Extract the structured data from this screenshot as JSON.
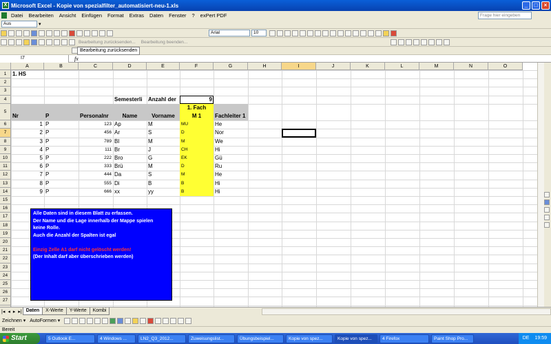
{
  "window": {
    "title": "Microsoft Excel - Kopie von spezialfilter_automatisiert-neu-1.xls",
    "minimize": "_",
    "maximize": "□",
    "close": "×"
  },
  "menu": [
    "Datei",
    "Bearbeiten",
    "Ansicht",
    "Einfügen",
    "Format",
    "Extras",
    "Daten",
    "Fenster",
    "?",
    "exPert PDF"
  ],
  "help_placeholder": "Frage hier eingeben",
  "toolbar1": {
    "combo": "Aus"
  },
  "toolbar2": {
    "font": "Arial",
    "size": "10",
    "review_back": "Bearbeitung zurücksenden...",
    "review_end": "Bearbeitung beenden...",
    "send_label": "Bearbeitung zurücksenden"
  },
  "formula": {
    "namebox": "I7",
    "fx": "fx",
    "value": ""
  },
  "columns": [
    "A",
    "B",
    "C",
    "D",
    "E",
    "F",
    "G",
    "H",
    "I",
    "J",
    "K",
    "L",
    "M",
    "N",
    "O"
  ],
  "rows": [
    "1",
    "2",
    "3",
    "4",
    "5",
    "6",
    "7",
    "8",
    "9",
    "10",
    "11",
    "12",
    "13",
    "14",
    "15",
    "16",
    "17",
    "18",
    "19",
    "20",
    "21",
    "22",
    "23",
    "24",
    "25",
    "26",
    "27",
    "28"
  ],
  "sheet": {
    "title": "1. HS",
    "semester_label": "Semesterli",
    "anzahl_label": "Anzahl der",
    "anzahl_value": "9",
    "headers": {
      "nr": "Nr",
      "p": "P",
      "personal": "Personalnr",
      "name": "Name",
      "vorname": "Vorname",
      "fach1": "1. Fach",
      "fach2": "M 1",
      "fachleiter": "Fachleiter 1"
    },
    "data": [
      {
        "nr": "1",
        "p": "P",
        "pn": "123",
        "name": "Ap",
        "vor": "M",
        "fach": "MU",
        "fl": "He"
      },
      {
        "nr": "2",
        "p": "P",
        "pn": "456",
        "name": "Ar",
        "vor": "S",
        "fach": "D",
        "fl": "Nor"
      },
      {
        "nr": "3",
        "p": "P",
        "pn": "789",
        "name": "Bl",
        "vor": "M",
        "fach": "M",
        "fl": "We"
      },
      {
        "nr": "4",
        "p": "P",
        "pn": "111",
        "name": "Br",
        "vor": "J",
        "fach": "CH",
        "fl": "Hi"
      },
      {
        "nr": "5",
        "p": "P",
        "pn": "222",
        "name": "Bro",
        "vor": "G",
        "fach": "EK",
        "fl": "Gü"
      },
      {
        "nr": "6",
        "p": "P",
        "pn": "333",
        "name": "Brü",
        "vor": "M",
        "fach": "D",
        "fl": "Ru"
      },
      {
        "nr": "7",
        "p": "P",
        "pn": "444",
        "name": "Da",
        "vor": "S",
        "fach": "M",
        "fl": "He"
      },
      {
        "nr": "8",
        "p": "P",
        "pn": "555",
        "name": "Di",
        "vor": "B",
        "fach": "B",
        "fl": "Hi"
      },
      {
        "nr": "9",
        "p": "P",
        "pn": "666",
        "name": "xx",
        "vor": "yy",
        "fach": "B",
        "fl": "Hi"
      }
    ],
    "note_lines": [
      "Alle Daten sind in diesem Blatt zu erfassen.",
      "Der Name und die Lage innerhalb der Mappe spielen",
      "keine Rolle.",
      "Auch die Anzahl der Spalten ist egal"
    ],
    "note_warning": "Einzig Zelle A1 darf nicht gelöscht werden!",
    "note_extra": "(Der Inhalt darf aber überschrieben werden)"
  },
  "tabs": [
    "Daten",
    "X-Werte",
    "Y-Werte",
    "Kombi"
  ],
  "drawbar": {
    "zeichnen": "Zeichnen ▾",
    "autoformen": "AutoFormen ▾"
  },
  "status": "Bereit",
  "taskbar": {
    "start": "Start",
    "tasks": [
      "5 Outlook E...",
      "4 Windows ...",
      "LN2_Q3_2012...",
      "Zuweisungslist...",
      "Übungsbeispiel...",
      "Kopie von spez...",
      "Kopie von spez...",
      "4 Firefox",
      "Paint Shop Pro..."
    ],
    "lang": "DE",
    "clock": "19:59"
  }
}
